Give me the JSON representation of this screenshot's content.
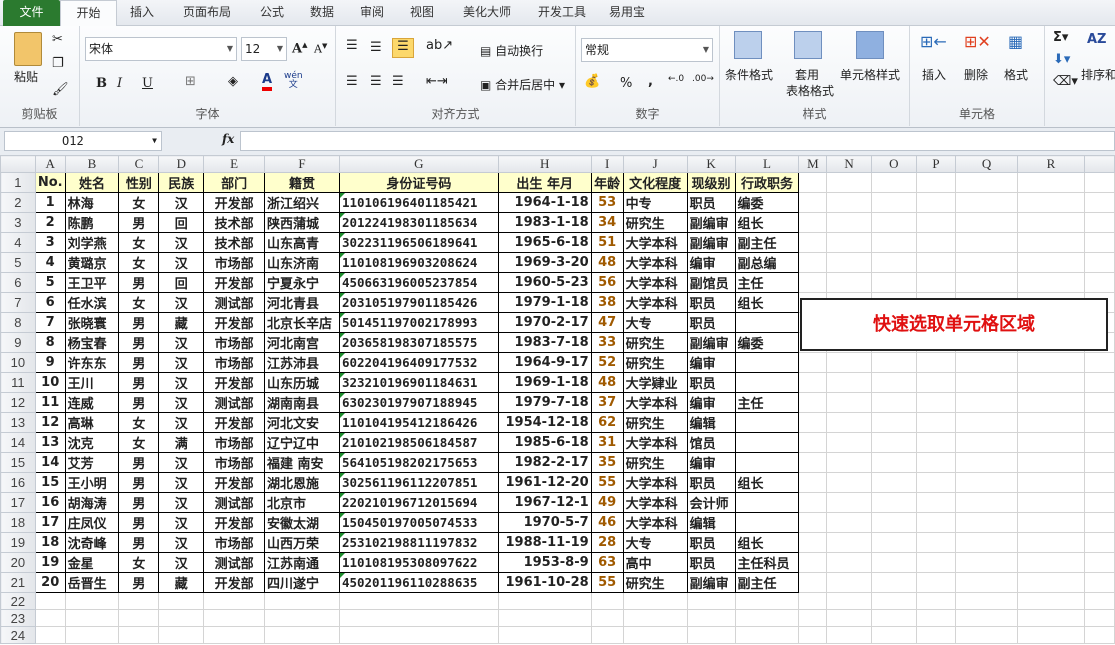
{
  "tabs": [
    "文件",
    "开始",
    "插入",
    "页面布局",
    "公式",
    "数据",
    "审阅",
    "视图",
    "美化大师",
    "开发工具",
    "易用宝"
  ],
  "ribbon": {
    "clipboard": {
      "label": "剪贴板",
      "paste": "粘贴"
    },
    "font": {
      "label": "字体",
      "name": "宋体",
      "size": "12",
      "bold": "B",
      "italic": "I",
      "underline": "U",
      "wen": "wén"
    },
    "align": {
      "label": "对齐方式",
      "wrap": "自动换行",
      "merge": "合并后居中"
    },
    "number": {
      "label": "数字",
      "format": "常规",
      "percent": "%",
      "comma": ","
    },
    "styles": {
      "label": "样式",
      "cond": "条件格式",
      "table1": "套用",
      "table2": "表格格式",
      "cell": "单元格样式"
    },
    "cells": {
      "label": "单元格",
      "insert": "插入",
      "delete": "删除",
      "format": "格式"
    },
    "edit": {
      "sort": "排序和"
    }
  },
  "formula_bar": {
    "name_box": "O12",
    "fx": "fx",
    "value": ""
  },
  "columns": [
    "A",
    "B",
    "C",
    "D",
    "E",
    "F",
    "G",
    "H",
    "I",
    "J",
    "K",
    "L",
    "M",
    "N",
    "O",
    "P",
    "Q",
    "R",
    ""
  ],
  "headers": [
    "No.",
    "姓名",
    "性别",
    "民族",
    "部门",
    "籍贯",
    "身份证号码",
    "出生 年月",
    "年龄",
    "文化程度",
    "现级别",
    "行政职务"
  ],
  "rows": [
    [
      "1",
      "林海",
      "女",
      "汉",
      "开发部",
      "浙江绍兴",
      "110106196401185421",
      "1964-1-18",
      "53",
      "中专",
      "职员",
      "编委"
    ],
    [
      "2",
      "陈鹏",
      "男",
      "回",
      "技术部",
      "陕西蒲城",
      "201224198301185634",
      "1983-1-18",
      "34",
      "研究生",
      "副编审",
      "组长"
    ],
    [
      "3",
      "刘学燕",
      "女",
      "汉",
      "技术部",
      "山东高青",
      "302231196506189641",
      "1965-6-18",
      "51",
      "大学本科",
      "副编审",
      "副主任"
    ],
    [
      "4",
      "黄璐京",
      "女",
      "汉",
      "市场部",
      "山东济南",
      "110108196903208624",
      "1969-3-20",
      "48",
      "大学本科",
      "编审",
      "副总编"
    ],
    [
      "5",
      "王卫平",
      "男",
      "回",
      "开发部",
      "宁夏永宁",
      "450663196005237854",
      "1960-5-23",
      "56",
      "大学本科",
      "副馆员",
      "主任"
    ],
    [
      "6",
      "任水滨",
      "女",
      "汉",
      "测试部",
      "河北青县",
      "203105197901185426",
      "1979-1-18",
      "38",
      "大学本科",
      "职员",
      "组长"
    ],
    [
      "7",
      "张晓寰",
      "男",
      "藏",
      "开发部",
      "北京长辛店",
      "501451197002178993",
      "1970-2-17",
      "47",
      "大专",
      "职员",
      ""
    ],
    [
      "8",
      "杨宝春",
      "男",
      "汉",
      "市场部",
      "河北南宫",
      "203658198307185575",
      "1983-7-18",
      "33",
      "研究生",
      "副编审",
      "编委"
    ],
    [
      "9",
      "许东东",
      "男",
      "汉",
      "市场部",
      "江苏沛县",
      "602204196409177532",
      "1964-9-17",
      "52",
      "研究生",
      "编审",
      ""
    ],
    [
      "10",
      "王川",
      "男",
      "汉",
      "开发部",
      "山东历城",
      "323210196901184631",
      "1969-1-18",
      "48",
      "大学肄业",
      "职员",
      ""
    ],
    [
      "11",
      "连威",
      "男",
      "汉",
      "测试部",
      "湖南南县",
      "630230197907188945",
      "1979-7-18",
      "37",
      "大学本科",
      "编审",
      "主任"
    ],
    [
      "12",
      "高琳",
      "女",
      "汉",
      "开发部",
      "河北文安",
      "110104195412186426",
      "1954-12-18",
      "62",
      "研究生",
      "编辑",
      ""
    ],
    [
      "13",
      "沈克",
      "女",
      "满",
      "市场部",
      "辽宁辽中",
      "210102198506184587",
      "1985-6-18",
      "31",
      "大学本科",
      "馆员",
      ""
    ],
    [
      "14",
      "艾芳",
      "男",
      "汉",
      "市场部",
      "福建 南安",
      "564105198202175653",
      "1982-2-17",
      "35",
      "研究生",
      "编审",
      ""
    ],
    [
      "15",
      "王小明",
      "男",
      "汉",
      "开发部",
      "湖北恩施",
      "302561196112207851",
      "1961-12-20",
      "55",
      "大学本科",
      "职员",
      "组长"
    ],
    [
      "16",
      "胡海涛",
      "男",
      "汉",
      "测试部",
      "北京市",
      "220210196712015694",
      "1967-12-1",
      "49",
      "大学本科",
      "会计师",
      ""
    ],
    [
      "17",
      "庄凤仪",
      "男",
      "汉",
      "开发部",
      "安徽太湖",
      "150450197005074533",
      "1970-5-7",
      "46",
      "大学本科",
      "编辑",
      ""
    ],
    [
      "18",
      "沈奇峰",
      "男",
      "汉",
      "市场部",
      "山西万荣",
      "253102198811197832",
      "1988-11-19",
      "28",
      "大专",
      "职员",
      "组长"
    ],
    [
      "19",
      "金星",
      "女",
      "汉",
      "测试部",
      "江苏南通",
      "110108195308097622",
      "1953-8-9",
      "63",
      "高中",
      "职员",
      "主任科员"
    ],
    [
      "20",
      "岳晋生",
      "男",
      "藏",
      "开发部",
      "四川遂宁",
      "450201196110288635",
      "1961-10-28",
      "55",
      "研究生",
      "副编审",
      "副主任"
    ]
  ],
  "callout": "快速选取单元格区域"
}
